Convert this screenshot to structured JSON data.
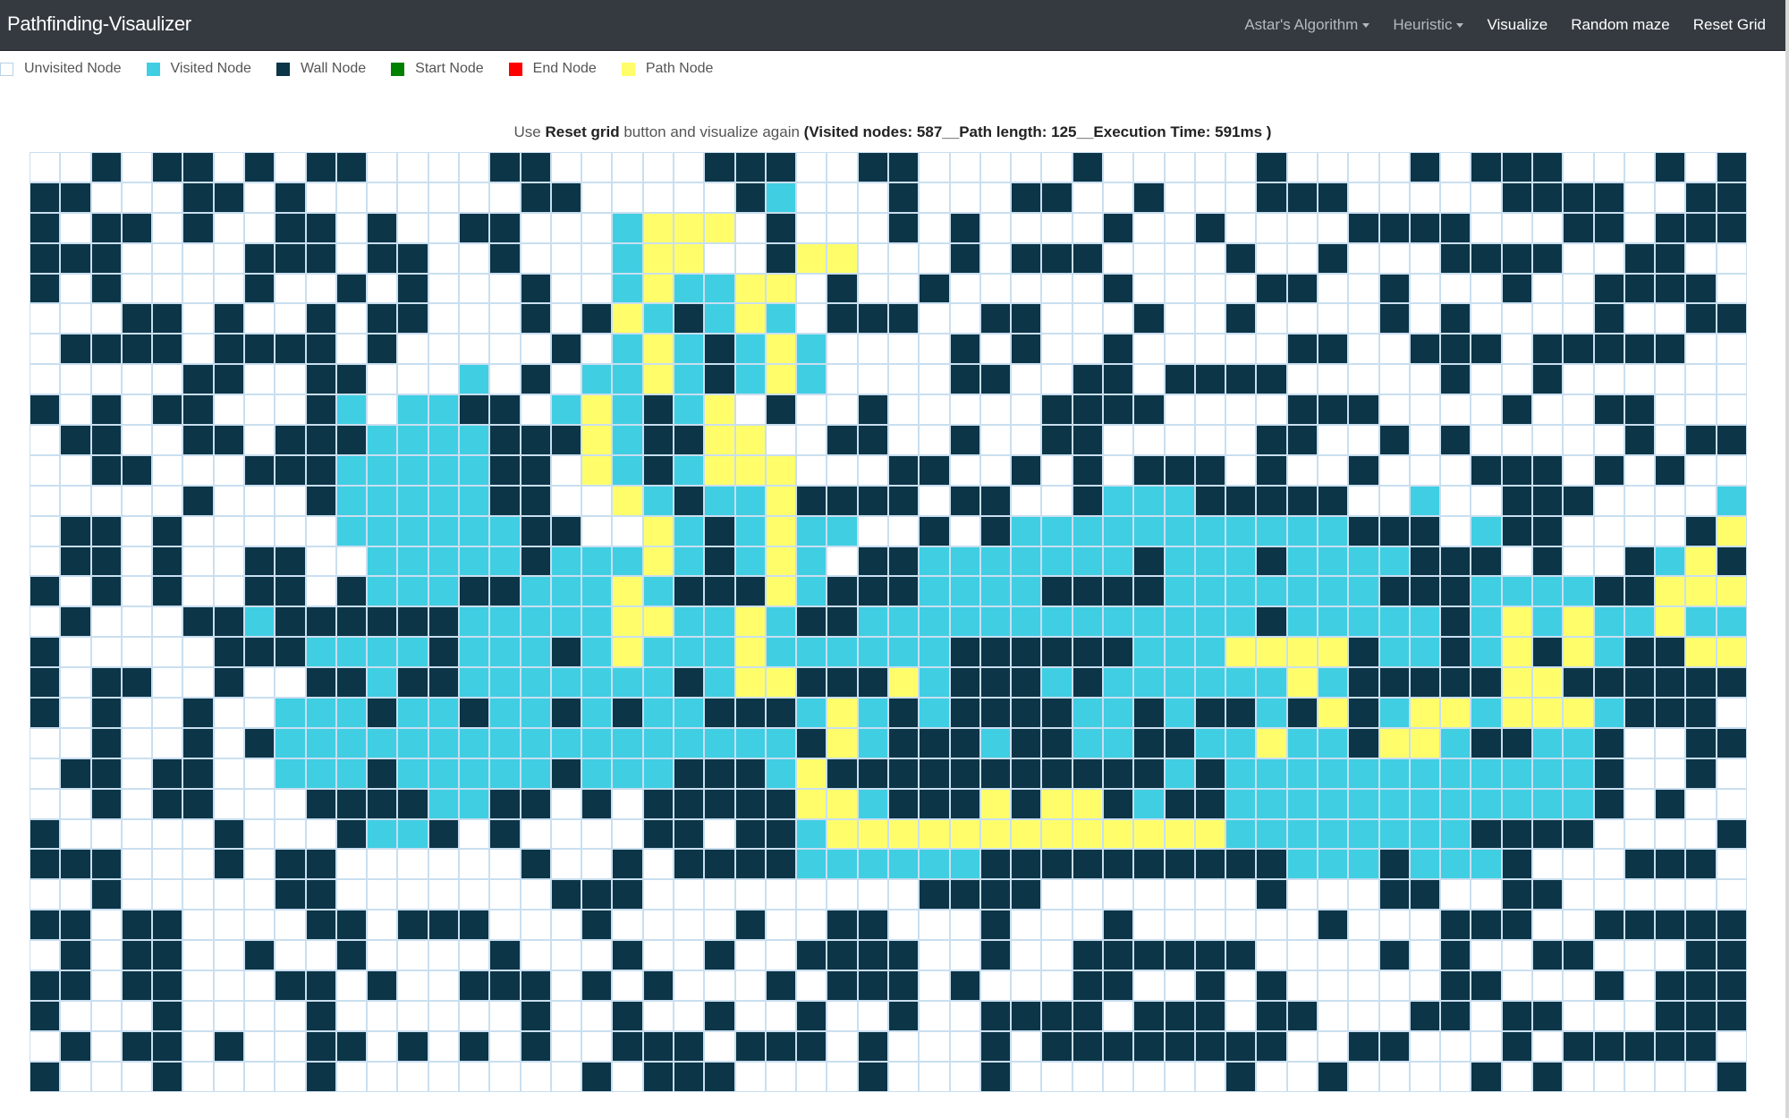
{
  "navbar": {
    "brand": "Pathfinding-Visaulizer",
    "items": [
      {
        "label": "Astar's Algorithm",
        "dropdown": true
      },
      {
        "label": "Heuristic",
        "dropdown": true
      },
      {
        "label": "Visualize",
        "dropdown": false
      },
      {
        "label": "Random maze",
        "dropdown": false
      },
      {
        "label": "Reset Grid",
        "dropdown": false
      }
    ]
  },
  "legend": [
    {
      "label": "Unvisited Node",
      "color": "#ffffff"
    },
    {
      "label": "Visited Node",
      "color": "#40cee3"
    },
    {
      "label": "Wall Node",
      "color": "#0c3547"
    },
    {
      "label": "Start Node",
      "color": "#008000"
    },
    {
      "label": "End Node",
      "color": "#ff0000"
    },
    {
      "label": "Path Node",
      "color": "#fffe6a"
    }
  ],
  "status": {
    "prefix": "Use ",
    "reset_label": "Reset grid",
    "middle": " button and visualize again ",
    "stats": "(Visited nodes: 587__Path length: 125__Execution Time: 591ms )"
  },
  "grid": {
    "columns": 56,
    "rows": [
      "..W.WW.W.WW....WW.....WWW..WW.....W.....W....W.WWW...W.W..W..WW.....WWWW.W..W.W.W.WWW..",
      "WW...WW.W.......WW.....WV...W...WW..W...WWW.....WWWW..WWWW......W....WW.WW...WW..W.....",
      "W.WW.W..WW.W..WW...VPPP.W...W.W....W..W....WWWW...WW.WWW..W.......WW.WW....",
      "WWW....WWW.WW..W...VPP..WPP...W.WWW....W..W...WWWW..WW...WWW.W..WW....W..WWW.W...W.W.WWW.",
      "W.W....W..W.W...W..VPVVPP.W..W.....W....WW..W...W..WWWW....W..W.WW...W..WW..W...W.WW..W",
      "...WW.W..W.WW...W.WPVWVPV.WWW..WW...W..W....W.W....W..WWW..W.....W.WW.W...WWWW..WW",
      ".WWWW.WWWW.W.....W.VPVWVPV....W.W..W.....WW..WWW.WWWWW....W.....W..W....W.WW.W..W.....",
      ".....WW..WW...V.W.VVPVWVPV....WW..WW.WWWW.....W..W.......WW.W.WW...WW.W.WWW..WW.WW..W",
      "W.W.WW...WV.VVWW.VPVWVP.W..W.....WWWW....WWW....W..WW.....W...W.W.WW......W..W.....W...W",
      ".WW..WW.WWWVVVVWWWPVWWPP..WW..W..WW.....WW..W.W.....W.WW..WW.W.WWW.WWW..W..W.WW..WWW..W.",
      "..WW...WWWVVVVVWW.PVWVPPP...WW..W.W.WWW.W..W...WWW.W.W..WWWW.W.W..W..WW.WWW.W.WWW....W..W",
      ".....W...WVVVVVWW..PVWVVPWWWW.WW..WVVVWWWWW..V..WWW....VVVWW...WW..WW.W..W..W.WW..W..W.W.",
      ".WW.W.....VVVVVVWW..PVWVPVV..W.WVVVVVVVVVVVWWW.VWW....WPPPVW....W.W.WW..WW......WWWW",
      ".WW.W..WW..VVVVVWVVVPVWVPV.WWVVVVVVVWVVVWVVVVWWW.W..WVPWWWW.WW.....WWWWW.....WWW..WW",
      "W.W.W..WW.WVVVWWVVVPVWWWPVWWWVVVVWWWWVVVVVVVWWWVVVVWWPPPPVV.WWW..W...W...WW..W.....W.W",
      ".W...WWVWWWWWWVVVVVPPVVPVWWVVVVVVVVVVVVVWVVVVVWVPVPVVPVVVVV.W...WWWW..WWW..WW.....WW..W",
      "W.....WWWVVVVWVVVWVPVVVPVVVVVVWWWWWWVVVPPPPWVVWVPWPVWWPPPPPVWWW..W....WW.W..WWW..W.....W",
      "W.WW..W..WWVWWVVVVVVVWVPPWWWPVWWWVWVVVVVVPVWWWWWPPWWWWWWWWWVVPW..WW..WWWW...W..W.W..WW...",
      "W.W..W..VVVWVVWVVWVWVVWWWVPVWVWWWWVVWVWWVWPWVPPVPPPVWWW..WWWW...W.....WW.W..WW....WW.W...",
      "..W..W.WVVVVVVVVVVVVVVVVVWPVWWWVWWVVWWVVPVVWPPVWWVVW..WWW..WWW....WWWWWW.WW....",
      ".WW.WW..VVVWVVVVVWVVVWWWVPWWWWWWWWWWWVWVVVVVVVVVVVVW..W..WW...WW...W..WW......W..W",
      "..W.WW...WWWWVVWW.W.WWWWWPPVWWWPWPPWVWWVVVVVVVVVVVVW.W.....W.W..W.W...W..W.W.....W...",
      "W.....W...WVVW.W....WW.WWVPPPPPPPPPPPPPVVVVVVVVWWWW....W......WW.WW.W...WW....W.W..W.",
      "WWW...W.WW......W..W.WWWWVVVVVVWWWWWWWWWWVVVWVVVW...WWW..WW.W.WWW..WWW...WW...W.W...W..W",
      "..W.....WW.......WWW.........WWWW.......W...WW..WW........WWWWW..W.....",
      "WW.WW....WW.WWW...W....W..WW...W...W......W...WWW..WWWWWWWW.....W....W.....",
      ".W.WW..W..W....W...W..W..WWWW..W..WWWWWW....W.W..WW...WWW.WW..WW.W.WW.W..W..W..WW..WW..WWWW",
      "WW.WW...WW.W..WWW.W.W...W.WWW.W...WW..W.W.....WW...W.WWW..WW..W...W.WW.WW.....W..WW",
      "W...W....W......W..W..W..W..W..WWWW.WWW.WW...WW.WW...WWW....WWW.......",
      ".W.WW.W..WW.W.W.W..WWW.WWW.W...W.WWWWWWWW..WW...W.WWWWW.WW...W.W....WWWW.WWW..W.W..W..WW.W.W",
      "W...W....W........W.WWW....W...W.......W..W....W.W.....W..W..W........W..W..W.W..W.WWW..WW"
    ]
  }
}
